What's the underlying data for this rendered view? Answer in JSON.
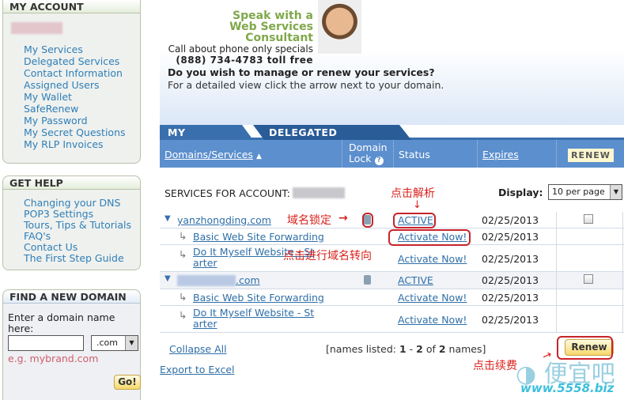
{
  "sidebar": {
    "my_account": {
      "title": "MY ACCOUNT",
      "items": [
        "My Services",
        "Delegated Services",
        "Contact Information",
        "Assigned Users",
        "My Wallet",
        "SafeRenew",
        "My Password",
        "My Secret Questions",
        "My RLP Invoices"
      ]
    },
    "get_help": {
      "title": "GET HELP",
      "items": [
        "Changing your DNS",
        "POP3 Settings",
        "Tours, Tips & Tutorials",
        "FAQ's",
        "Contact Us",
        "The First Step Guide"
      ]
    },
    "find_domain": {
      "title": "FIND A NEW DOMAIN",
      "label": "Enter a domain name here:",
      "input_value": "",
      "tld": ".com",
      "example": "e.g. mybrand.com",
      "go": "Go!"
    }
  },
  "promo": {
    "line1": "Speak with a",
    "line2": "Web Services Consultant",
    "line3": "Call about phone only specials",
    "phone": "(888) 734-4783 toll free"
  },
  "intro": {
    "question": "Do you wish to manage or renew your services?",
    "hint": "For a detailed view click the arrow next to your domain."
  },
  "tabs": [
    "MY ACCOUNTS",
    "DELEGATED ACCOUNTS"
  ],
  "columns": {
    "domains": "Domains/Services",
    "lock1": "Domain",
    "lock2": "Lock",
    "status": "Status",
    "expires": "Expires",
    "renew": "RENEW"
  },
  "account_label": "SERVICES FOR ACCOUNT:",
  "display": {
    "label": "Display:",
    "value": "10 per page"
  },
  "rows": [
    {
      "name": "yanzhongding.com",
      "status": "ACTIVE",
      "expires": "02/25/2013"
    },
    {
      "name": "Basic Web Site Forwarding",
      "status": "Activate Now!",
      "expires": "02/25/2013"
    },
    {
      "name1": "Do It Myself Website - St",
      "name2": "arter",
      "status": "Activate Now!",
      "expires": "02/25/2013"
    },
    {
      "name": ".com",
      "status": "ACTIVE",
      "expires": "02/25/2013"
    },
    {
      "name": "Basic Web Site Forwarding",
      "status": "Activate Now!",
      "expires": "02/25/2013"
    },
    {
      "name1": "Do It Myself Website - St",
      "name2": "arter",
      "status": "Activate Now!",
      "expires": "02/25/2013"
    }
  ],
  "footer": {
    "collapse": "Collapse All",
    "listed_pre": "[names listed: ",
    "from": "1",
    "dash": " - ",
    "to": "2",
    "of": " of ",
    "total": "2",
    "suffix": " names]",
    "renew": "Renew",
    "export": "Export to Excel"
  },
  "annotations": {
    "dns": "点击解析",
    "lock": "域名锁定",
    "forward": "点击进行域名转向",
    "renew": "点击续费"
  },
  "watermark": {
    "text": "便宜吧",
    "url": "www.5558.biz"
  }
}
